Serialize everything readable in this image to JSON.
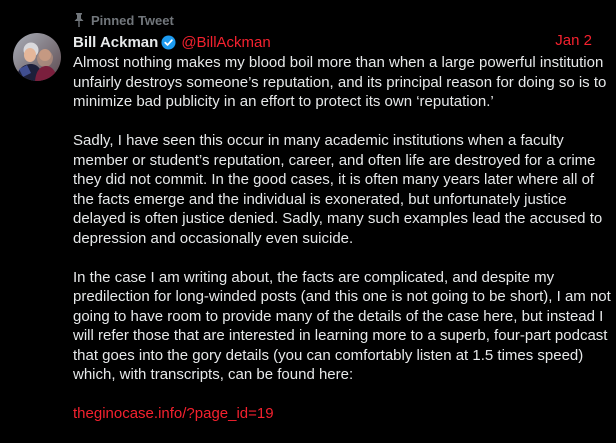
{
  "pinned": {
    "label": "Pinned Tweet"
  },
  "author": {
    "name": "Bill Ackman",
    "handle": "@BillAckman",
    "verified_color": "#1d9bf0"
  },
  "date": "Jan 2",
  "body": {
    "paragraphs": [
      "Almost nothing makes my blood boil more than when a large powerful institution unfairly destroys someone’s reputation, and its principal reason for doing so is to minimize bad publicity in an effort to protect its own ‘reputation.’",
      "Sadly, I have seen this occur in many academic institutions when a faculty member or student’s reputation, career, and often life are destroyed for a crime they did not commit. In the good cases, it is often many years later where all of the facts emerge and the individual is exonerated, but unfortunately justice delayed is often justice denied. Sadly, many such examples lead the accused to depression and occasionally even suicide.",
      "In the case I am writing about, the facts are complicated, and despite my predilection for long-winded posts (and this one is not going to be short), I am not going to have room to provide many of the details of the case here, but instead I will refer those that are interested in learning more to a superb, four-part podcast that goes into the gory details (you can comfortably listen at 1.5 times speed) which, with transcripts, can be found here:"
    ],
    "link": "theginocase.info/?page_id=19"
  },
  "colors": {
    "background": "#000000",
    "text": "#e7e9ea",
    "muted": "#71767b",
    "accent": "#f4212e"
  },
  "icons": {
    "pin": "pin-icon",
    "verified": "verified-badge-icon"
  }
}
